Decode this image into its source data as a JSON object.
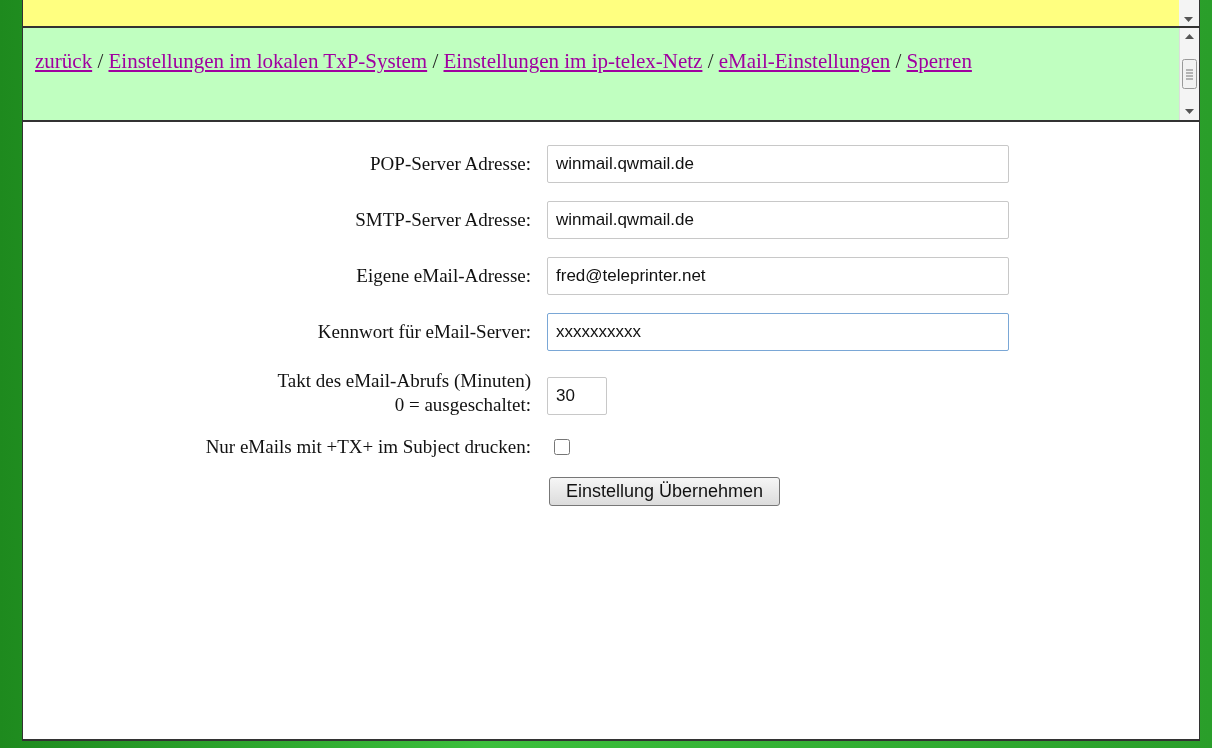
{
  "breadcrumb": [
    {
      "kind": "link",
      "text": "zurück"
    },
    {
      "kind": "separator",
      "text": "/"
    },
    {
      "kind": "link",
      "text": "Einstellungen im lokalen TxP-System"
    },
    {
      "kind": "separator",
      "text": "/"
    },
    {
      "kind": "link",
      "text": "Einstellungen im ip-telex-Netz"
    },
    {
      "kind": "separator",
      "text": "/"
    },
    {
      "kind": "link",
      "text": "eMail-Einstellungen"
    },
    {
      "kind": "separator",
      "text": "/"
    },
    {
      "kind": "link",
      "text": "Sperren"
    }
  ],
  "form": {
    "fields": [
      {
        "kind": "text",
        "label": [
          "POP-Server Adresse:"
        ],
        "value": "winmail.qwmail.de",
        "focused": false
      },
      {
        "kind": "text",
        "label": [
          "SMTP-Server Adresse:"
        ],
        "value": "winmail.qwmail.de",
        "focused": false
      },
      {
        "kind": "text",
        "label": [
          "Eigene eMail-Adresse:"
        ],
        "value": "fred@teleprinter.net",
        "focused": false
      },
      {
        "kind": "text",
        "label": [
          "Kennwort für eMail-Server:"
        ],
        "value": "xxxxxxxxxx",
        "focused": true
      },
      {
        "kind": "short",
        "label": [
          "Takt des eMail-Abrufs (Minuten)",
          "0 = ausgeschaltet:"
        ],
        "value": "30",
        "focused": false
      },
      {
        "kind": "checkbox",
        "label": [
          "Nur eMails mit +TX+ im Subject drucken:"
        ],
        "checked": false
      }
    ],
    "submit": "Einstellung Übernehmen"
  }
}
